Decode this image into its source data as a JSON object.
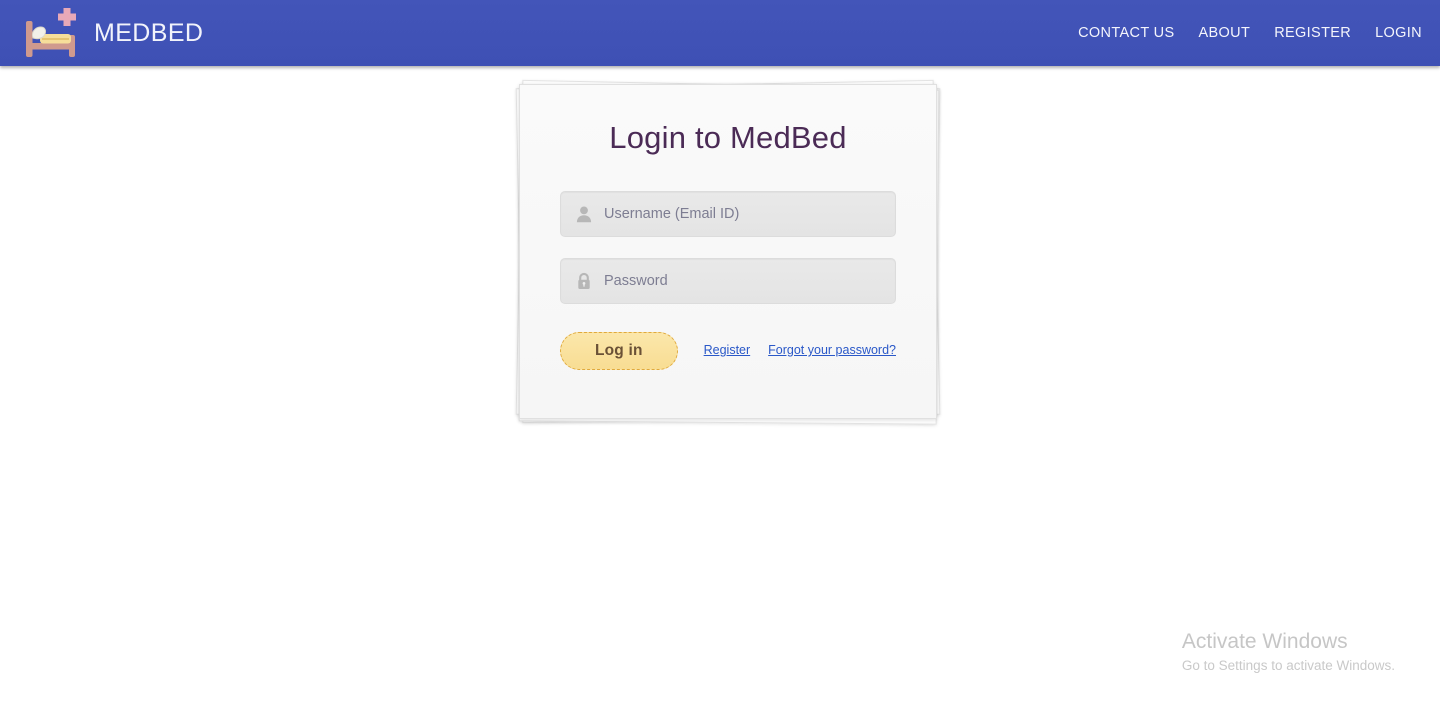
{
  "header": {
    "brand_name": "MEDBED",
    "brand_logo_icon": "hospital-bed-icon",
    "nav_links": [
      {
        "label": "CONTACT US",
        "name": "nav-link-contact-us"
      },
      {
        "label": "ABOUT",
        "name": "nav-link-about"
      },
      {
        "label": "REGISTER",
        "name": "nav-link-register"
      },
      {
        "label": "LOGIN",
        "name": "nav-link-login"
      }
    ],
    "background_color": "#3f51b5",
    "text_color": "#f4f5fc"
  },
  "login_card": {
    "title": "Login to MedBed",
    "title_color": "#4b2b56",
    "username": {
      "placeholder": "Username (Email ID)",
      "value": "",
      "icon": "user-icon"
    },
    "password": {
      "placeholder": "Password",
      "value": "",
      "icon": "lock-icon"
    },
    "submit_label": "Log in",
    "submit_color": "#fae3a0",
    "submit_border_color": "#e0a93c",
    "links": [
      {
        "label": "Register",
        "name": "register-link"
      },
      {
        "label": "Forgot your password?",
        "name": "forgot-password-link"
      }
    ],
    "link_color": "#2a58c8"
  },
  "watermark": {
    "title": "Activate Windows",
    "subtitle": "Go to Settings to activate Windows.",
    "color": "#c6c6c6"
  }
}
